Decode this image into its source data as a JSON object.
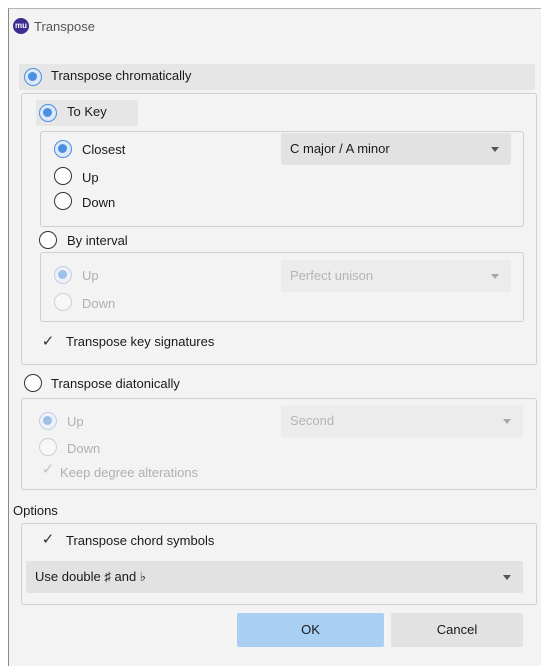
{
  "window": {
    "title": "Transpose",
    "close_glyph": "›",
    "app_icon_glyph": "mu"
  },
  "chromatic": {
    "label": "Transpose chromatically",
    "selected": true,
    "to_key": {
      "label": "To Key",
      "selected": true,
      "options": [
        {
          "label": "Closest",
          "selected": true
        },
        {
          "label": "Up",
          "selected": false
        },
        {
          "label": "Down",
          "selected": false
        }
      ],
      "key_select": "C major / A minor"
    },
    "by_interval": {
      "label": "By interval",
      "selected": false,
      "options": [
        {
          "label": "Up",
          "selected": true
        },
        {
          "label": "Down",
          "selected": false
        }
      ],
      "interval_select": "Perfect unison"
    },
    "transpose_key_signatures": {
      "label": "Transpose key signatures",
      "checked": true
    }
  },
  "diatonic": {
    "label": "Transpose diatonically",
    "selected": false,
    "options": [
      {
        "label": "Up",
        "selected": true
      },
      {
        "label": "Down",
        "selected": false
      }
    ],
    "degree_select": "Second",
    "keep_degree_alterations": {
      "label": "Keep degree alterations",
      "checked": true
    }
  },
  "options": {
    "heading": "Options",
    "chord_symbols": {
      "label": "Transpose chord symbols",
      "checked": true
    },
    "accidentals_select": "Use double ♯ and  ♭"
  },
  "buttons": {
    "ok": "OK",
    "cancel": "Cancel"
  },
  "colors": {
    "accent": "#4a90e2",
    "ok_button": "#a9cff2",
    "cancel_button": "#e2e2e2"
  }
}
